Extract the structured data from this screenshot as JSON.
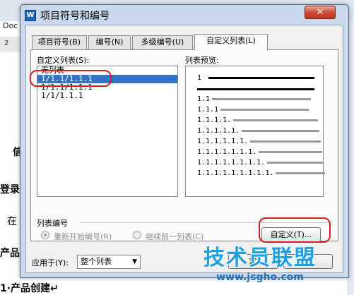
{
  "background": {
    "tab_text": "Doc",
    "ruler_text": "2",
    "doc_lines": [
      "信",
      "登录",
      "在",
      "产品",
      "1·产品创建↵"
    ]
  },
  "dialog": {
    "title": "项目符号和编号",
    "app_icon": "W",
    "close_label": "✕",
    "tabs": [
      {
        "label": "项目符号(B)"
      },
      {
        "label": "编号(N)"
      },
      {
        "label": "多级编号(U)"
      },
      {
        "label": "自定义列表(L)"
      }
    ],
    "active_tab": 3,
    "list_label": "自定义列表(S):",
    "list_items": [
      "无列表",
      "1/1.1/1.1.1",
      "1/1.1/1.1.1",
      "1/1/1.1.1"
    ],
    "selected_index": 1,
    "preview_label": "列表预览:",
    "preview_rows": [
      "1",
      "",
      "1.1",
      "1.1.1",
      "1.1.1.1.",
      "1.1.1.1.1.",
      "1.1.1.1.1.1.",
      "1.1.1.1.1.1.1.",
      "1.1.1.1.1.1.1.1.",
      "1.1.1.1.1.1.1.1.1."
    ],
    "numbering_group_label": "列表编号",
    "radio_restart_label": "重新开始编号(R)",
    "radio_continue_label": "继续前一列表(C)",
    "customize_button": "自定义(T)...",
    "apply_to_label": "应用于(Y):",
    "apply_to_value": "整个列表",
    "ok_button_partial": "定",
    "highlight_color": "#d81f1f"
  },
  "watermark": {
    "text": "技术员联盟",
    "url": "www.jsgho.com"
  }
}
